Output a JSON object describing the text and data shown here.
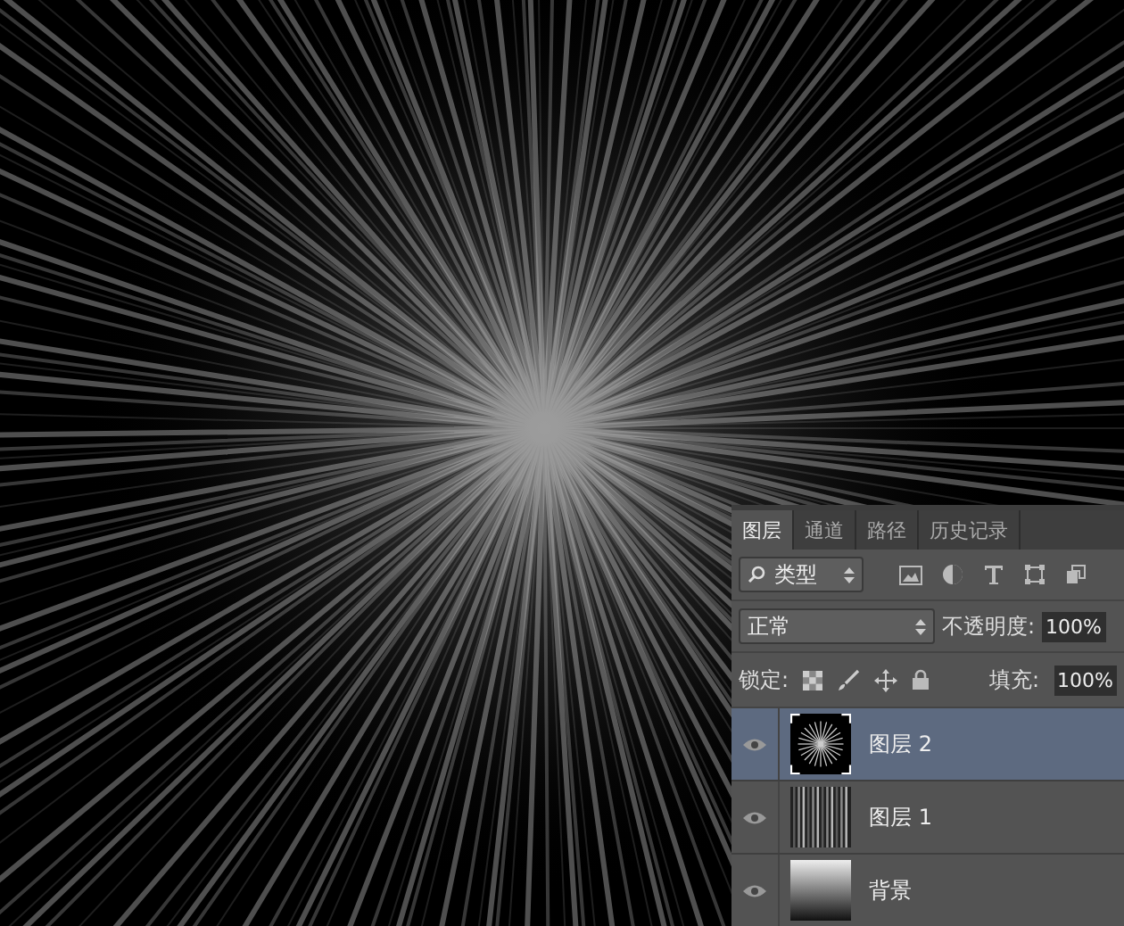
{
  "layers_panel": {
    "tabs": [
      {
        "label": "图层",
        "selected": true
      },
      {
        "label": "通道",
        "selected": false
      },
      {
        "label": "路径",
        "selected": false
      },
      {
        "label": "历史记录",
        "selected": false
      }
    ],
    "filter": {
      "label": "类型",
      "icons": [
        {
          "kind": "image"
        },
        {
          "kind": "adjust"
        },
        {
          "kind": "text"
        },
        {
          "kind": "shape"
        },
        {
          "kind": "smart"
        }
      ]
    },
    "blend_mode": "正常",
    "opacity_label": "不透明度:",
    "opacity": "100%",
    "lock_label": "锁定:",
    "fill_label": "填充:",
    "fill": "100%",
    "layers": [
      {
        "name": "图层 2",
        "selected": true,
        "visible": true,
        "kind": "burst"
      },
      {
        "name": "图层 1",
        "selected": false,
        "visible": true,
        "kind": "streaks"
      },
      {
        "name": "背景",
        "selected": false,
        "visible": true,
        "kind": "gradient"
      }
    ]
  }
}
